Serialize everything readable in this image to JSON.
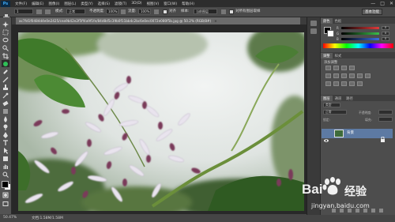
{
  "app": {
    "logo": "Ps"
  },
  "menu": [
    "文件(F)",
    "编辑(E)",
    "图像(I)",
    "图层(L)",
    "类型(Y)",
    "选择(S)",
    "滤镜(T)",
    "3D(D)",
    "视图(V)",
    "窗口(W)",
    "帮助(H)"
  ],
  "window_controls": [
    "—",
    "□",
    "✕"
  ],
  "options": {
    "tool_preset": "",
    "size_value": "1",
    "mode_label": "模式:",
    "mode_value": "正常",
    "opacity_label": "不透明度:",
    "opacity_value": "100%",
    "flow_label": "流量:",
    "flow_value": "100%",
    "aligned_label": "对齐",
    "sample_label": "样本:",
    "sample_value": "当前图层",
    "checkbox_label": "对所有图层取样",
    "workspace_button": "基本功能"
  },
  "document": {
    "tab_title": "ac7fd1f0484d4e0e2425/cea9b42e2f5ff4a9f1fe/84d8d5c39b0f11bb4c2bc6e0ec0072e080f5b.jpg @ 50.2% (RGB/8#)",
    "close_symbol": "×"
  },
  "status": {
    "zoom": "50.47%",
    "doc_info": "文档:1.58M/1.58M"
  },
  "panels": {
    "color_tabs": [
      "颜色",
      "色板"
    ],
    "sliders": [
      {
        "label": "R",
        "value": "0",
        "color": "#e23b3b"
      },
      {
        "label": "G",
        "value": "0",
        "color": "#3bbf4a"
      },
      {
        "label": "B",
        "value": "0",
        "color": "#3b6fe2"
      }
    ],
    "adjust_tabs": [
      "调整",
      "样式"
    ],
    "adjust_title": "添加调整",
    "layers_tabs": [
      "图层",
      "通道",
      "路径"
    ],
    "kind_label": "类型",
    "blend_mode": "正常",
    "opacity_label": "不透明度:",
    "lock_label": "锁定:",
    "fill_label": "填充:",
    "layer_name": "背景"
  },
  "watermark": {
    "brand": "Bai",
    "brand2": "经验",
    "url": "jingyan.baidu.com"
  },
  "colors": {
    "foreground": "#000000",
    "background": "#ffffff",
    "accent_layer": "#5d7aa3"
  }
}
